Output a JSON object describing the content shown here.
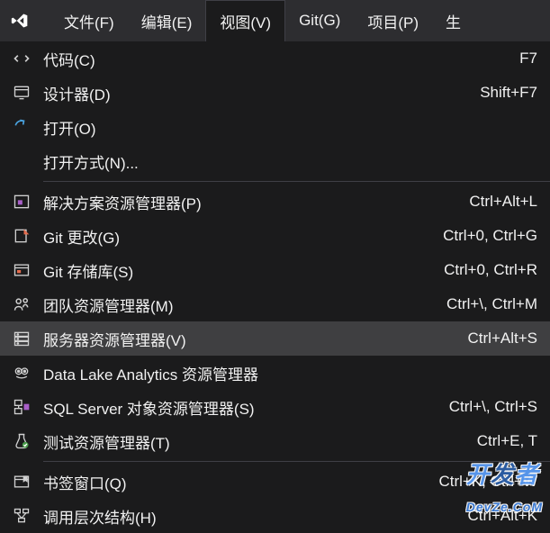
{
  "menubar": {
    "items": [
      {
        "label": "文件(F)"
      },
      {
        "label": "编辑(E)"
      },
      {
        "label": "视图(V)"
      },
      {
        "label": "Git(G)"
      },
      {
        "label": "项目(P)"
      },
      {
        "label": "生"
      }
    ],
    "open_index": 2
  },
  "dropdown": {
    "groups": [
      [
        {
          "icon": "code-icon",
          "label": "代码(C)",
          "shortcut": "F7"
        },
        {
          "icon": "designer-icon",
          "label": "设计器(D)",
          "shortcut": "Shift+F7"
        },
        {
          "icon": "open-icon",
          "label": "打开(O)",
          "shortcut": ""
        },
        {
          "icon": "",
          "label": "打开方式(N)...",
          "shortcut": ""
        }
      ],
      [
        {
          "icon": "solution-explorer-icon",
          "label": "解决方案资源管理器(P)",
          "shortcut": "Ctrl+Alt+L"
        },
        {
          "icon": "git-changes-icon",
          "label": "Git 更改(G)",
          "shortcut": "Ctrl+0, Ctrl+G"
        },
        {
          "icon": "git-repo-icon",
          "label": "Git 存储库(S)",
          "shortcut": "Ctrl+0, Ctrl+R"
        },
        {
          "icon": "team-explorer-icon",
          "label": "团队资源管理器(M)",
          "shortcut": "Ctrl+\\, Ctrl+M"
        },
        {
          "icon": "server-explorer-icon",
          "label": "服务器资源管理器(V)",
          "shortcut": "Ctrl+Alt+S",
          "highlighted": true
        },
        {
          "icon": "datalake-icon",
          "label": "Data Lake Analytics 资源管理器",
          "shortcut": ""
        },
        {
          "icon": "sql-server-icon",
          "label": "SQL Server 对象资源管理器(S)",
          "shortcut": "Ctrl+\\, Ctrl+S"
        },
        {
          "icon": "test-explorer-icon",
          "label": "测试资源管理器(T)",
          "shortcut": "Ctrl+E, T"
        }
      ],
      [
        {
          "icon": "bookmark-icon",
          "label": "书签窗口(Q)",
          "shortcut": "Ctrl+K, Ctrl+W"
        },
        {
          "icon": "call-hierarchy-icon",
          "label": "调用层次结构(H)",
          "shortcut": "Ctrl+Alt+K"
        }
      ]
    ]
  },
  "watermark": {
    "text1": "开",
    "text2": "发",
    "text3": "者"
  },
  "watermark_sub": "DevZe.CoM"
}
